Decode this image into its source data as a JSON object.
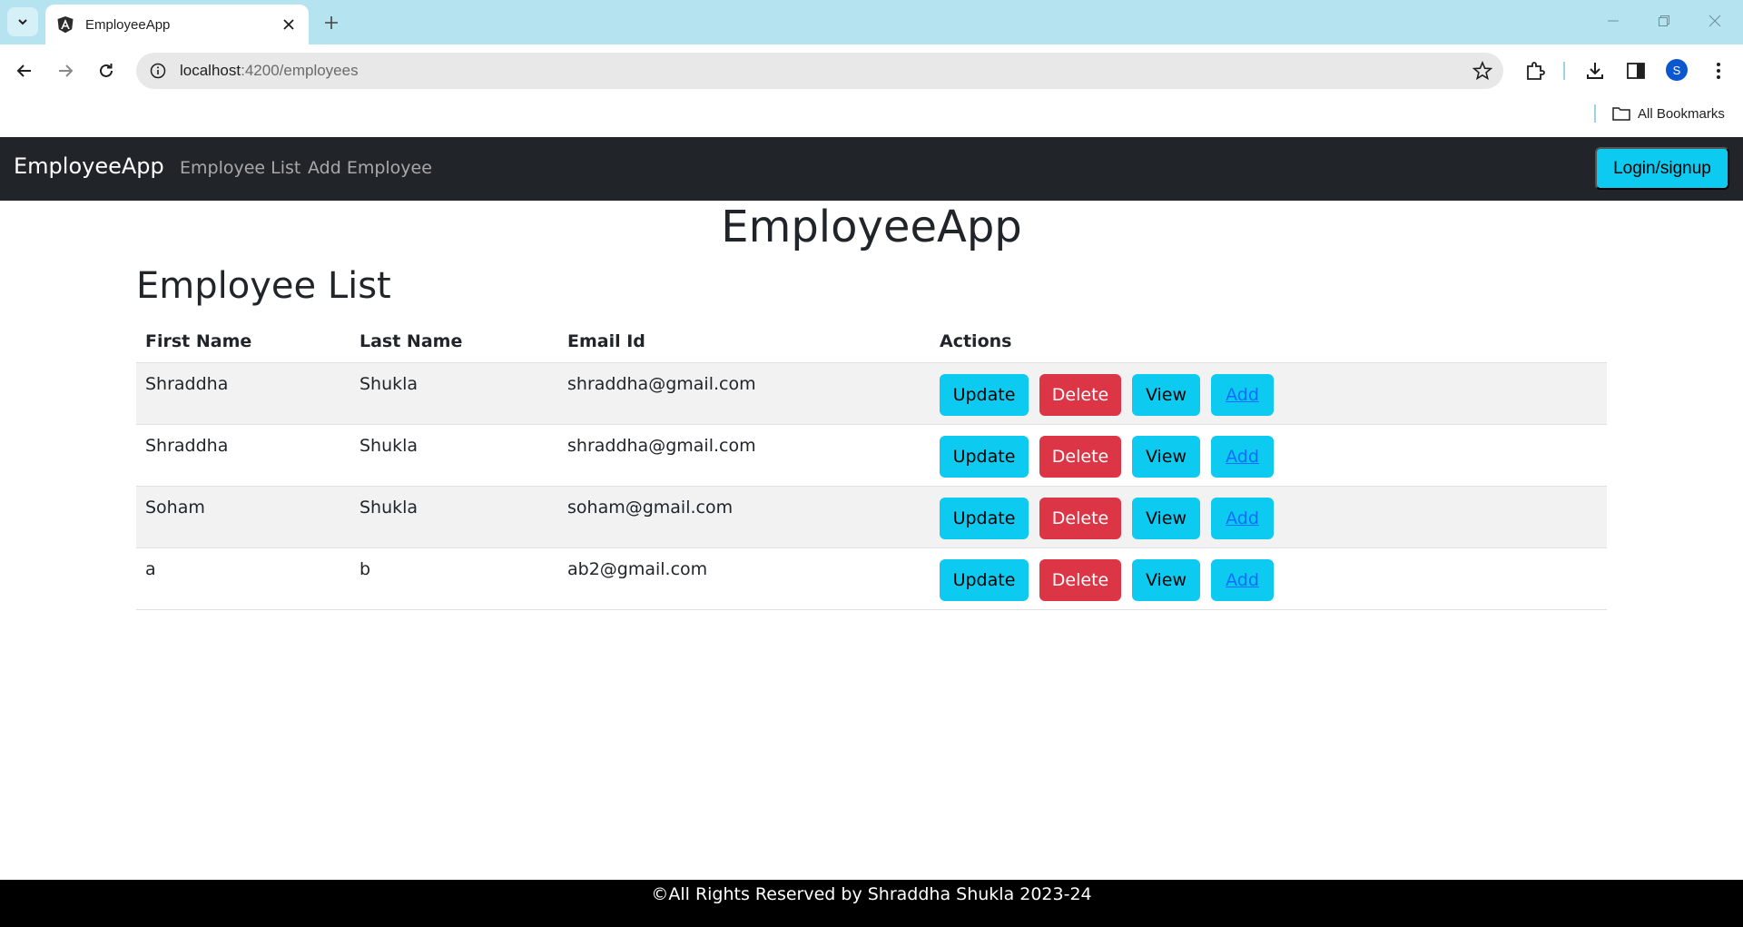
{
  "browser": {
    "tab_title": "EmployeeApp",
    "url_host": "localhost",
    "url_path": ":4200/employees",
    "bookmarks_label": "All Bookmarks",
    "profile_initial": "S"
  },
  "navbar": {
    "brand": "EmployeeApp",
    "links": [
      "Employee List",
      "Add Employee"
    ],
    "login_label": "Login/signup"
  },
  "main": {
    "heading": "EmployeeApp",
    "section_title": "Employee List",
    "columns": [
      "First Name",
      "Last Name",
      "Email Id",
      "Actions"
    ],
    "rows": [
      {
        "first": "Shraddha",
        "last": "Shukla",
        "email": "shraddha@gmail.com"
      },
      {
        "first": "Shraddha",
        "last": "Shukla",
        "email": "shraddha@gmail.com"
      },
      {
        "first": "Soham",
        "last": "Shukla",
        "email": "soham@gmail.com"
      },
      {
        "first": "a",
        "last": "b",
        "email": "ab2@gmail.com"
      }
    ],
    "actions": {
      "update": "Update",
      "delete": "Delete",
      "view": "View",
      "add": "Add"
    }
  },
  "footer": {
    "text": "©All Rights Reserved by Shraddha Shukla 2023-24"
  },
  "colors": {
    "tabstrip": "#b6e3f0",
    "navbar": "#212529",
    "info": "#0dcaf0",
    "danger": "#dc3545",
    "link": "#0d6efd",
    "footer": "#000000"
  },
  "icons": {
    "tab_search": "chevron-down-icon",
    "favicon": "angular-icon",
    "tab_close": "close-icon",
    "new_tab": "plus-icon",
    "back": "arrow-left-icon",
    "forward": "arrow-right-icon",
    "reload": "reload-icon",
    "site_info": "info-icon",
    "bookmark": "star-icon",
    "extensions": "puzzle-icon",
    "downloads": "download-icon",
    "side_panel": "side-panel-icon",
    "menu": "more-vert-icon",
    "bookmarks_folder": "folder-icon"
  }
}
